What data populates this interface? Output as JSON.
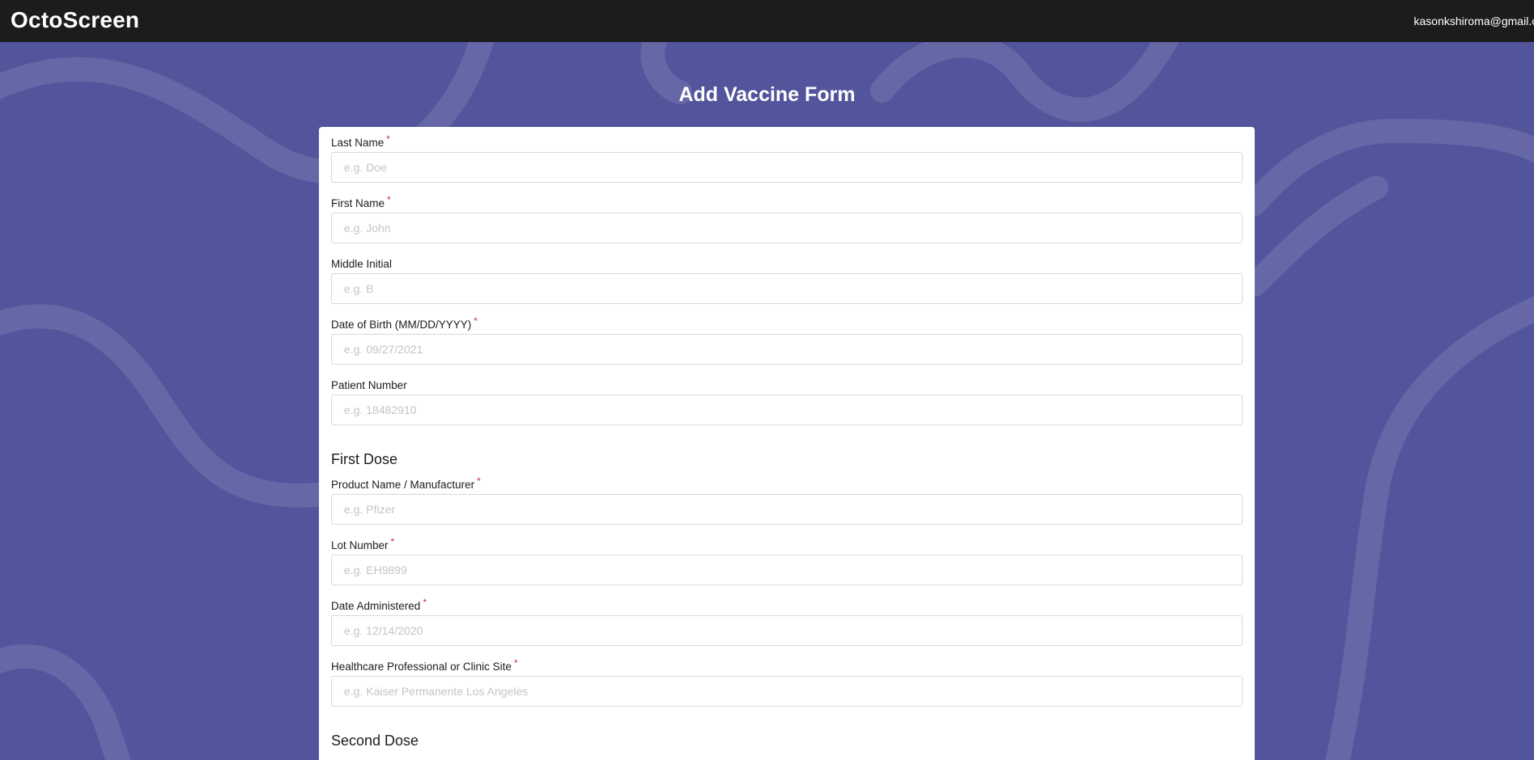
{
  "app": {
    "brand": "OctoScreen",
    "user_email": "kasonkshiroma@gmail.co"
  },
  "page": {
    "title": "Add Vaccine Form"
  },
  "fields": {
    "last_name": {
      "label": "Last Name",
      "required": "*",
      "placeholder": "e.g. Doe",
      "value": ""
    },
    "first_name": {
      "label": "First Name",
      "required": "*",
      "placeholder": "e.g. John",
      "value": ""
    },
    "middle_initial": {
      "label": "Middle Initial",
      "placeholder": "e.g. B",
      "value": ""
    },
    "dob": {
      "label": "Date of Birth (MM/DD/YYYY)",
      "required": "*",
      "placeholder": "e.g. 09/27/2021",
      "value": ""
    },
    "patient_number": {
      "label": "Patient Number",
      "placeholder": "e.g. 18482910",
      "value": ""
    }
  },
  "first_dose": {
    "heading": "First Dose",
    "product": {
      "label": "Product Name / Manufacturer",
      "required": "*",
      "placeholder": "e.g. Pfizer",
      "value": ""
    },
    "lot": {
      "label": "Lot Number",
      "required": "*",
      "placeholder": "e.g. EH9899",
      "value": ""
    },
    "date": {
      "label": "Date Administered",
      "required": "*",
      "placeholder": "e.g. 12/14/2020",
      "value": ""
    },
    "site": {
      "label": "Healthcare Professional or Clinic Site",
      "required": "*",
      "placeholder": "e.g. Kaiser Permanente Los Angeles",
      "value": ""
    }
  },
  "second_dose": {
    "heading": "Second Dose"
  },
  "colors": {
    "topbar": "#1b1c1e",
    "background": "#52559c",
    "required_marker": "#d23030"
  }
}
